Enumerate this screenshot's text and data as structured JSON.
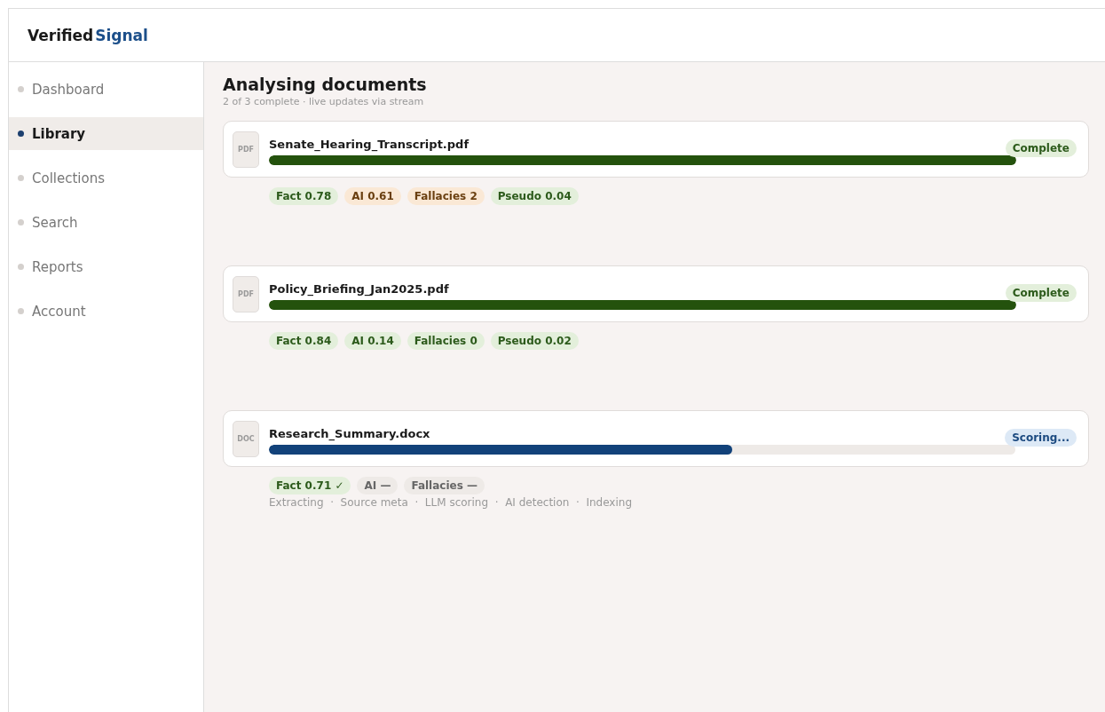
{
  "brand": {
    "name": "Verified",
    "accent": "Signal"
  },
  "sidebar": {
    "items": [
      {
        "label": "Dashboard",
        "selected": false
      },
      {
        "label": "Library",
        "selected": true
      },
      {
        "label": "Collections",
        "selected": false
      },
      {
        "label": "Search",
        "selected": false
      },
      {
        "label": "Reports",
        "selected": false
      },
      {
        "label": "Account",
        "selected": false
      }
    ]
  },
  "main": {
    "title": "Analysing documents",
    "subtitle": "2 of 3 complete · live updates via stream",
    "documents": [
      {
        "type": "PDF",
        "name": "Senate_Hearing_Transcript.pdf",
        "level": 1,
        "status": {
          "kind": "complete",
          "label": "Complete"
        },
        "scores": [
          {
            "label": "Fact 0.78",
            "kind": "good"
          },
          {
            "label": "AI 0.61",
            "kind": "warn"
          },
          {
            "label": "Fallacies 2",
            "kind": "warn"
          },
          {
            "label": "Pseudo 0.04",
            "kind": "good"
          }
        ]
      },
      {
        "type": "PDF",
        "name": "Policy_Briefing_Jan2025.pdf",
        "level": 1,
        "status": {
          "kind": "complete",
          "label": "Complete"
        },
        "scores": [
          {
            "label": "Fact 0.84",
            "kind": "good"
          },
          {
            "label": "AI 0.14",
            "kind": "good"
          },
          {
            "label": "Fallacies 0",
            "kind": "good"
          },
          {
            "label": "Pseudo 0.02",
            "kind": "good"
          }
        ]
      },
      {
        "type": "DOC",
        "name": "Research_Summary.docx",
        "level": 0.62,
        "status": {
          "kind": "scoring",
          "label": "Scoring..."
        },
        "scores": [
          {
            "label": "Fact 0.71 ✓",
            "kind": "good"
          },
          {
            "label": "AI —",
            "kind": "pending"
          },
          {
            "label": "Fallacies —",
            "kind": "pending"
          }
        ],
        "stages": "Extracting  ·  Source meta  ·  LLM scoring  ·  AI detection  ·  Indexing"
      }
    ]
  }
}
